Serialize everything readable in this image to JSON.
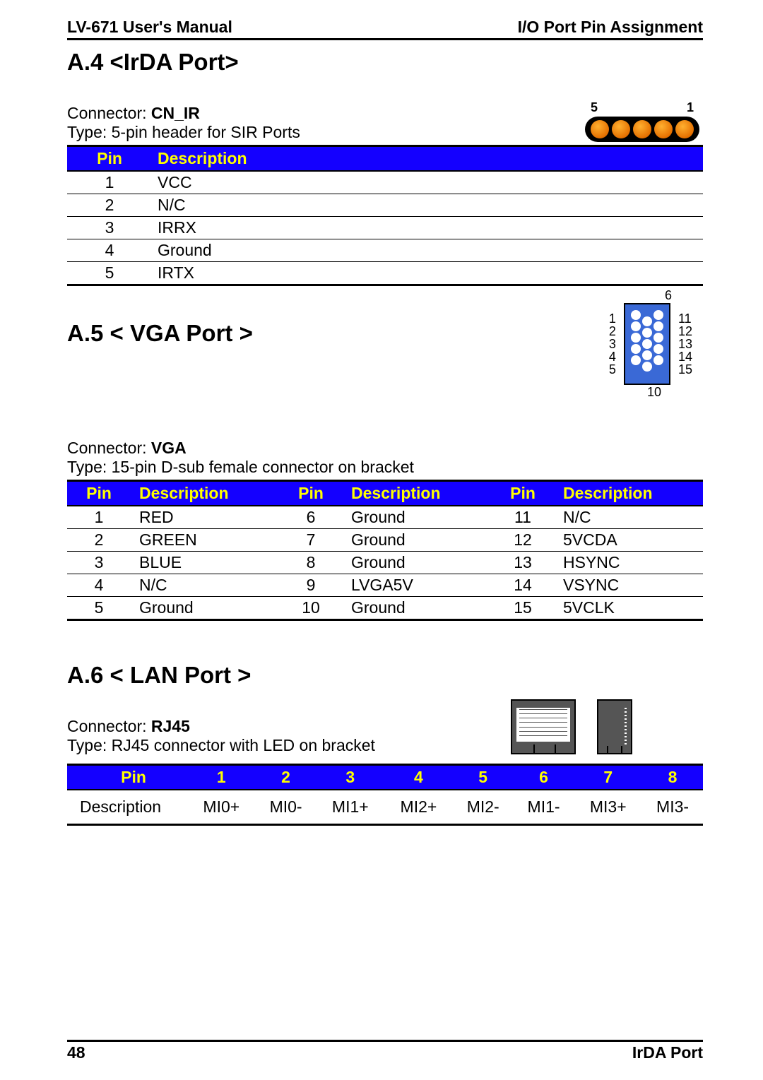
{
  "header": {
    "left": "LV-671 User's Manual",
    "right": "I/O Port Pin Assignment"
  },
  "sectionA4": {
    "title": "A.4 <IrDA Port>",
    "connector_label": "Connector: ",
    "connector_name": "CN_IR",
    "type": "Type: 5-pin header for SIR Ports",
    "diagram": {
      "label_left": "5",
      "label_right": "1"
    },
    "table": {
      "headers": [
        "Pin",
        "Description"
      ],
      "rows": [
        {
          "pin": "1",
          "desc": "VCC"
        },
        {
          "pin": "2",
          "desc": "N/C"
        },
        {
          "pin": "3",
          "desc": "IRRX"
        },
        {
          "pin": "4",
          "desc": "Ground"
        },
        {
          "pin": "5",
          "desc": "IRTX"
        }
      ]
    }
  },
  "sectionA5": {
    "title": "A.5 < VGA Port >",
    "connector_label": "Connector: ",
    "connector_name": "VGA",
    "type": "Type: 15-pin D-sub female connector on bracket",
    "diagram": {
      "top": "6",
      "left": [
        "1",
        "2",
        "3",
        "4",
        "5"
      ],
      "right": [
        "11",
        "12",
        "13",
        "14",
        "15"
      ],
      "bottom": "10"
    },
    "table": {
      "headers": [
        "Pin",
        "Description",
        "Pin",
        "Description",
        "Pin",
        "Description"
      ],
      "rows": [
        {
          "p1": "1",
          "d1": "RED",
          "p2": "6",
          "d2": "Ground",
          "p3": "11",
          "d3": "N/C"
        },
        {
          "p1": "2",
          "d1": "GREEN",
          "p2": "7",
          "d2": "Ground",
          "p3": "12",
          "d3": "5VCDA"
        },
        {
          "p1": "3",
          "d1": "BLUE",
          "p2": "8",
          "d2": "Ground",
          "p3": "13",
          "d3": "HSYNC"
        },
        {
          "p1": "4",
          "d1": "N/C",
          "p2": "9",
          "d2": "LVGA5V",
          "p3": "14",
          "d3": "VSYNC"
        },
        {
          "p1": "5",
          "d1": "Ground",
          "p2": "10",
          "d2": "Ground",
          "p3": "15",
          "d3": "5VCLK"
        }
      ]
    }
  },
  "sectionA6": {
    "title": "A.6 < LAN Port >",
    "connector_label": "Connector: ",
    "connector_name": "RJ45",
    "type": "Type: RJ45 connector with LED on bracket",
    "table": {
      "head_label": "Pin",
      "pins": [
        "1",
        "2",
        "3",
        "4",
        "5",
        "6",
        "7",
        "8"
      ],
      "desc_label": "Description",
      "descs": [
        "MI0+",
        "MI0-",
        "MI1+",
        "MI2+",
        "MI2-",
        "MI1-",
        "MI3+",
        "MI3-"
      ]
    }
  },
  "footer": {
    "page": "48",
    "section": "IrDA Port"
  }
}
